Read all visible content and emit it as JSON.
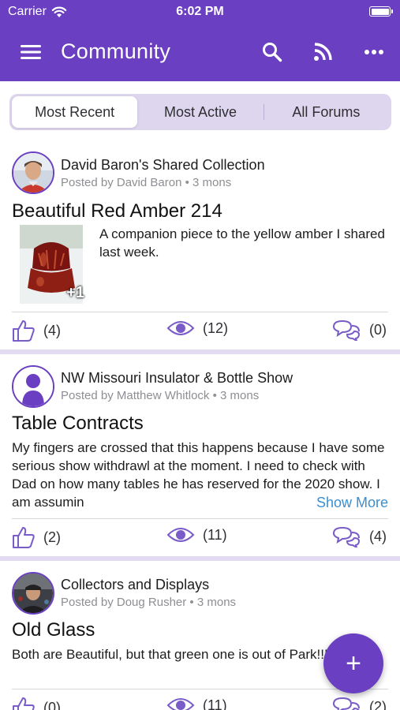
{
  "status_bar": {
    "carrier": "Carrier",
    "time": "6:02 PM"
  },
  "app_bar": {
    "title": "Community"
  },
  "tabs": [
    {
      "label": "Most Recent",
      "active": true
    },
    {
      "label": "Most Active",
      "active": false
    },
    {
      "label": "All Forums",
      "active": false
    }
  ],
  "colors": {
    "brand": "#6a3fc1",
    "tab_track": "#ded6ef",
    "link": "#3b8fd0"
  },
  "posts": [
    {
      "forum": "David Baron's Shared Collection",
      "posted_by": "Posted by David Baron",
      "age": "3 mons",
      "title": "Beautiful Red Amber 214",
      "excerpt": "A companion piece to the yellow amber I shared last week.",
      "extra_images": "+1",
      "likes": "(4)",
      "views": "(12)",
      "comments": "(0)"
    },
    {
      "forum": "NW Missouri Insulator & Bottle Show",
      "posted_by": "Posted by Matthew Whitlock",
      "age": "3 mons",
      "title": "Table Contracts",
      "excerpt": "My fingers are crossed that this happens because I have some serious show withdrawl at the moment. I need to check with Dad on how many tables he has reserved for the 2020 show. I am assumin",
      "show_more": "Show More",
      "likes": "(2)",
      "views": "(11)",
      "comments": "(4)"
    },
    {
      "forum": "Collectors and Displays",
      "posted_by": "Posted by Doug Rusher",
      "age": "3 mons",
      "title": "Old Glass",
      "excerpt": "Both are Beautiful, but that green one is out of Park!!!!",
      "likes": "(0)",
      "views": "(11)",
      "comments": "(2)"
    }
  ],
  "fab": {
    "label": "+"
  }
}
